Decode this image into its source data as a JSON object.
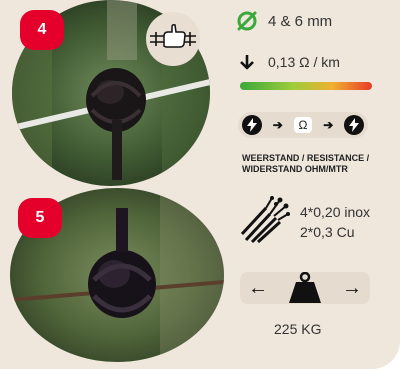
{
  "badges": {
    "top": "4",
    "bottom": "5"
  },
  "icons": {
    "grip": "grip-wire-icon",
    "diameter": "diameter-icon",
    "resistance": "down-arrow-icon",
    "lightning": "lightning-icon",
    "wire": "wire-strands-icon",
    "weight": "weight-icon"
  },
  "specs": {
    "diameter": "4 & 6 mm",
    "resistance": "0,13 Ω / km",
    "ohm_symbol": "Ω",
    "resistance_label": "WEERSTAND / RESISTANCE / WIDERSTAND OHM/MTR",
    "wire_line1": "4*0,20 inox",
    "wire_line2": "2*0,3 Cu",
    "breaking_force": "225 KG"
  },
  "colors": {
    "badge_red": "#e4002b",
    "diameter_green": "#3aa83a",
    "background": "#efe6dc"
  }
}
